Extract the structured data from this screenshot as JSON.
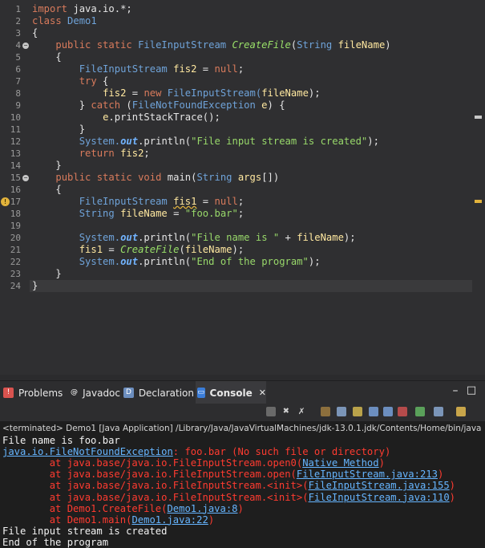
{
  "editor": {
    "line_numbers": [
      "1",
      "2",
      "3",
      "4",
      "5",
      "6",
      "7",
      "8",
      "9",
      "10",
      "11",
      "12",
      "13",
      "14",
      "15",
      "16",
      "17",
      "18",
      "19",
      "20",
      "21",
      "22",
      "23",
      "24"
    ],
    "lines": [
      [
        {
          "t": "import",
          "c": "kw"
        },
        {
          "t": " java.io.*;",
          "c": "pl"
        }
      ],
      [
        {
          "t": "class",
          "c": "kw"
        },
        {
          "t": " Demo1",
          "c": "ty"
        }
      ],
      [
        {
          "t": "{",
          "c": "pl"
        }
      ],
      [
        {
          "t": "    ",
          "c": "pl"
        },
        {
          "t": "public static",
          "c": "kw"
        },
        {
          "t": " FileInputStream ",
          "c": "ty"
        },
        {
          "t": "CreateFile",
          "c": "mi"
        },
        {
          "t": "(",
          "c": "pl"
        },
        {
          "t": "String",
          "c": "ty"
        },
        {
          "t": " fileName",
          "c": "ob"
        },
        {
          "t": ")",
          "c": "pl"
        }
      ],
      [
        {
          "t": "    {",
          "c": "pl"
        }
      ],
      [
        {
          "t": "        ",
          "c": "pl"
        },
        {
          "t": "FileInputStream",
          "c": "ty"
        },
        {
          "t": " fis2 ",
          "c": "ob"
        },
        {
          "t": "= ",
          "c": "pl"
        },
        {
          "t": "null",
          "c": "kw"
        },
        {
          "t": ";",
          "c": "pl"
        }
      ],
      [
        {
          "t": "        ",
          "c": "pl"
        },
        {
          "t": "try",
          "c": "kw"
        },
        {
          "t": " {",
          "c": "pl"
        }
      ],
      [
        {
          "t": "            ",
          "c": "pl"
        },
        {
          "t": "fis2",
          "c": "ob"
        },
        {
          "t": " = ",
          "c": "pl"
        },
        {
          "t": "new",
          "c": "kw"
        },
        {
          "t": " FileInputStream(",
          "c": "ty"
        },
        {
          "t": "fileName",
          "c": "ob"
        },
        {
          "t": ");",
          "c": "pl"
        }
      ],
      [
        {
          "t": "        } ",
          "c": "pl"
        },
        {
          "t": "catch",
          "c": "kw"
        },
        {
          "t": " (",
          "c": "pl"
        },
        {
          "t": "FileNotFoundException",
          "c": "ty"
        },
        {
          "t": " e",
          "c": "ob"
        },
        {
          "t": ") {",
          "c": "pl"
        }
      ],
      [
        {
          "t": "            ",
          "c": "pl"
        },
        {
          "t": "e",
          "c": "ob"
        },
        {
          "t": ".printStackTrace();",
          "c": "pl"
        }
      ],
      [
        {
          "t": "        }",
          "c": "pl"
        }
      ],
      [
        {
          "t": "        ",
          "c": "pl"
        },
        {
          "t": "System.",
          "c": "ty"
        },
        {
          "t": "out",
          "c": "sf"
        },
        {
          "t": ".println(",
          "c": "pl"
        },
        {
          "t": "\"File input stream is created\"",
          "c": "st"
        },
        {
          "t": ");",
          "c": "pl"
        }
      ],
      [
        {
          "t": "        ",
          "c": "pl"
        },
        {
          "t": "return",
          "c": "kw"
        },
        {
          "t": " fis2",
          "c": "ob"
        },
        {
          "t": ";",
          "c": "pl"
        }
      ],
      [
        {
          "t": "    }",
          "c": "pl"
        }
      ],
      [
        {
          "t": "    ",
          "c": "pl"
        },
        {
          "t": "public static void",
          "c": "kw"
        },
        {
          "t": " main(",
          "c": "pl"
        },
        {
          "t": "String",
          "c": "ty"
        },
        {
          "t": " args",
          "c": "ob"
        },
        {
          "t": "[])",
          "c": "pl"
        }
      ],
      [
        {
          "t": "    {",
          "c": "pl"
        }
      ],
      [
        {
          "t": "        ",
          "c": "pl"
        },
        {
          "t": "FileInputStream",
          "c": "ty"
        },
        {
          "t": " ",
          "c": "pl"
        },
        {
          "t": "fis1",
          "c": "ob wavy"
        },
        {
          "t": " = ",
          "c": "pl"
        },
        {
          "t": "null",
          "c": "kw"
        },
        {
          "t": ";",
          "c": "pl"
        }
      ],
      [
        {
          "t": "        ",
          "c": "pl"
        },
        {
          "t": "String",
          "c": "ty"
        },
        {
          "t": " fileName",
          "c": "ob"
        },
        {
          "t": " = ",
          "c": "pl"
        },
        {
          "t": "\"foo.bar\"",
          "c": "st"
        },
        {
          "t": ";",
          "c": "pl"
        }
      ],
      [
        {
          "t": "",
          "c": "pl"
        }
      ],
      [
        {
          "t": "        ",
          "c": "pl"
        },
        {
          "t": "System.",
          "c": "ty"
        },
        {
          "t": "out",
          "c": "sf"
        },
        {
          "t": ".println(",
          "c": "pl"
        },
        {
          "t": "\"File name is \"",
          "c": "st"
        },
        {
          "t": " + ",
          "c": "pl"
        },
        {
          "t": "fileName",
          "c": "ob"
        },
        {
          "t": ");",
          "c": "pl"
        }
      ],
      [
        {
          "t": "        ",
          "c": "pl"
        },
        {
          "t": "fis1",
          "c": "ob"
        },
        {
          "t": " = ",
          "c": "pl"
        },
        {
          "t": "CreateFile",
          "c": "mi"
        },
        {
          "t": "(",
          "c": "pl"
        },
        {
          "t": "fileName",
          "c": "ob"
        },
        {
          "t": ");",
          "c": "pl"
        }
      ],
      [
        {
          "t": "        ",
          "c": "pl"
        },
        {
          "t": "System.",
          "c": "ty"
        },
        {
          "t": "out",
          "c": "sf"
        },
        {
          "t": ".println(",
          "c": "pl"
        },
        {
          "t": "\"End of the program\"",
          "c": "st"
        },
        {
          "t": ");",
          "c": "pl"
        }
      ],
      [
        {
          "t": "    }",
          "c": "pl"
        }
      ],
      [
        {
          "t": "}",
          "c": "pl"
        }
      ]
    ],
    "fold_icon": "fold-collapse-icon",
    "warning_icon": "warning-lightbulb-icon"
  },
  "views": {
    "tabs": [
      {
        "label": "Problems",
        "icon": "problems-icon",
        "icon_glyph": "!",
        "icon_color": "#d9534f"
      },
      {
        "label": "Javadoc",
        "icon": "javadoc-icon",
        "icon_glyph": "@",
        "icon_color": "#2d2d2f"
      },
      {
        "label": "Declaration",
        "icon": "declaration-icon",
        "icon_glyph": "D",
        "icon_color": "#6c8ebf"
      },
      {
        "label": "Console",
        "icon": "console-icon",
        "icon_glyph": "▭",
        "icon_color": "#3b7dd8"
      }
    ],
    "close_glyph": "✕",
    "minimize_glyph": "–",
    "maximize_glyph": "□"
  },
  "console": {
    "header": "<terminated> Demo1 [Java Application] /Library/Java/JavaVirtualMachines/jdk-13.0.1.jdk/Contents/Home/bin/java",
    "lines": [
      [
        {
          "t": "File name is foo.bar",
          "c": "out"
        }
      ],
      [
        {
          "t": "java.io.FileNotFoundException",
          "c": "lnk"
        },
        {
          "t": ": foo.bar (No such file or directory)",
          "c": "err"
        }
      ],
      [
        {
          "t": "        at java.base/java.io.FileInputStream.open0(",
          "c": "err"
        },
        {
          "t": "Native Method",
          "c": "lnk"
        },
        {
          "t": ")",
          "c": "err"
        }
      ],
      [
        {
          "t": "        at java.base/java.io.FileInputStream.open(",
          "c": "err"
        },
        {
          "t": "FileInputStream.java:213",
          "c": "lnk"
        },
        {
          "t": ")",
          "c": "err"
        }
      ],
      [
        {
          "t": "        at java.base/java.io.FileInputStream.<init>(",
          "c": "err"
        },
        {
          "t": "FileInputStream.java:155",
          "c": "lnk"
        },
        {
          "t": ")",
          "c": "err"
        }
      ],
      [
        {
          "t": "        at java.base/java.io.FileInputStream.<init>(",
          "c": "err"
        },
        {
          "t": "FileInputStream.java:110",
          "c": "lnk"
        },
        {
          "t": ")",
          "c": "err"
        }
      ],
      [
        {
          "t": "        at Demo1.CreateFile(",
          "c": "err"
        },
        {
          "t": "Demo1.java:8",
          "c": "lnk"
        },
        {
          "t": ")",
          "c": "err"
        }
      ],
      [
        {
          "t": "        at Demo1.main(",
          "c": "err"
        },
        {
          "t": "Demo1.java:22",
          "c": "lnk"
        },
        {
          "t": ")",
          "c": "err"
        }
      ],
      [
        {
          "t": "File input stream is created",
          "c": "out"
        }
      ],
      [
        {
          "t": "End of the program",
          "c": "out"
        }
      ]
    ]
  },
  "colors": {
    "editor_bg": "#2f2f31",
    "console_bg": "#1e1e1e",
    "error": "#ff3b30",
    "link": "#66b5ff"
  }
}
